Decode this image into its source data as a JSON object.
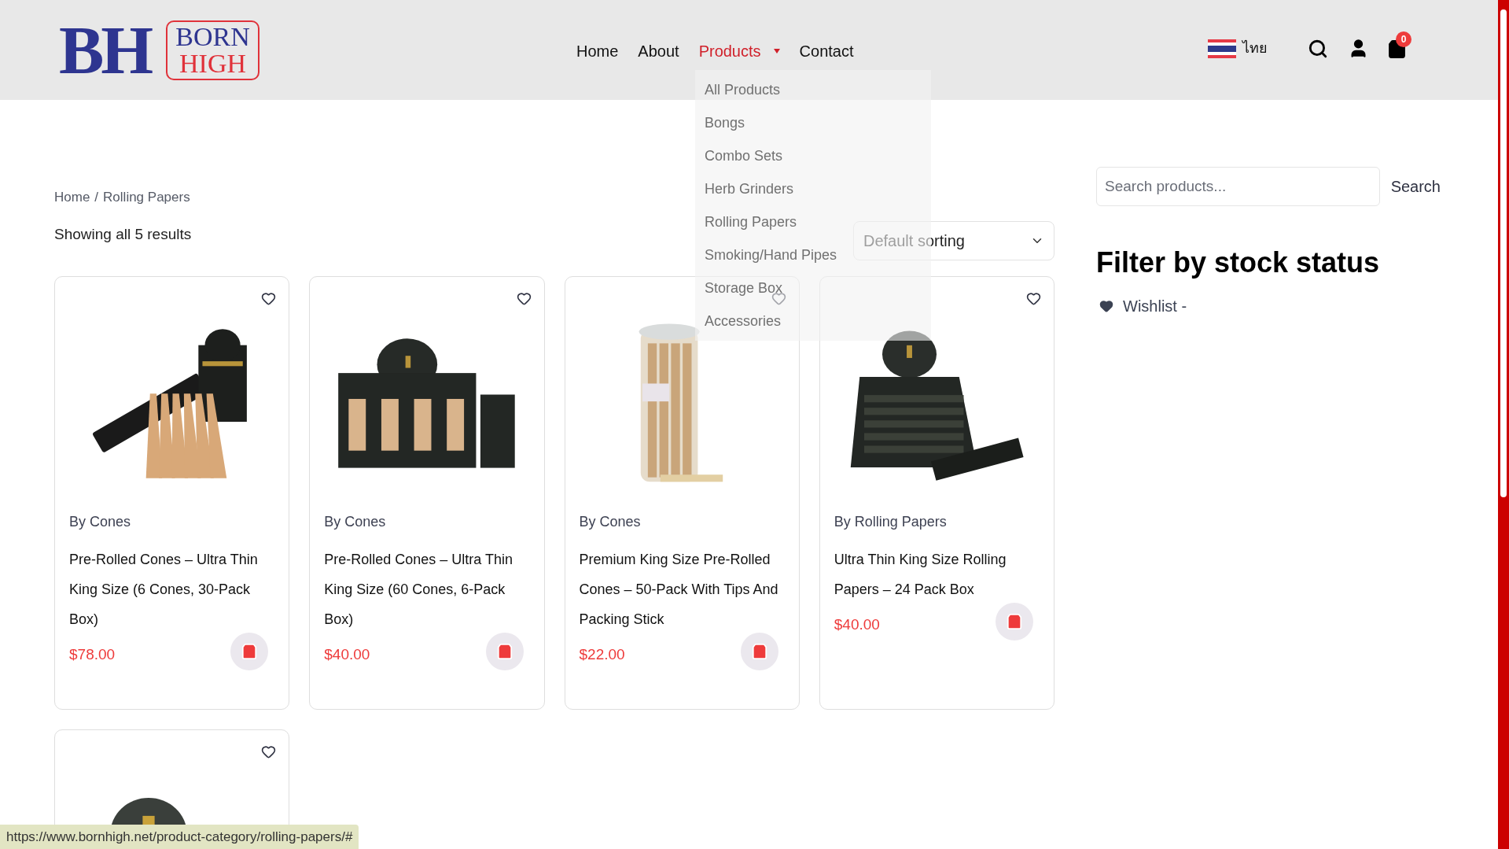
{
  "header": {
    "logo": {
      "monogram": "BH",
      "line1": "BORN",
      "line2": "HIGH"
    },
    "nav": [
      {
        "label": "Home",
        "selected": false,
        "has_menu": false
      },
      {
        "label": "About",
        "selected": false,
        "has_menu": false
      },
      {
        "label": "Products",
        "selected": true,
        "has_menu": true
      },
      {
        "label": "Contact",
        "selected": false,
        "has_menu": false
      }
    ],
    "language": "ไทย",
    "cart_count": "0"
  },
  "dropdown": [
    "All Products",
    "Bongs",
    "Combo Sets",
    "Herb Grinders",
    "Rolling Papers",
    "Smoking/Hand Pipes",
    "Storage Box",
    "Accessories"
  ],
  "breadcrumb": {
    "items": [
      "Home",
      "Rolling Papers"
    ],
    "separator": "/"
  },
  "result_count": "Showing all 5 results",
  "sorting": "Default sorting",
  "products": [
    {
      "category": "By Cones",
      "title": "Pre-Rolled Cones – Ultra Thin King Size (6 Cones, 30-Pack Box)",
      "price": "$78.00",
      "kind": "cones"
    },
    {
      "category": "By Cones",
      "title": "Pre-Rolled Cones – Ultra Thin King Size (60 Cones, 6-Pack Box)",
      "price": "$40.00",
      "kind": "display"
    },
    {
      "category": "By Cones",
      "title": "Premium King Size Pre-Rolled Cones – 50-Pack With Tips And Packing Stick",
      "price": "$22.00",
      "kind": "jar"
    },
    {
      "category": "By Rolling Papers",
      "title": "Ultra Thin King Size Rolling Papers – 24 Pack Box",
      "price": "$40.00",
      "kind": "papers"
    },
    {
      "kind": "partial"
    }
  ],
  "sidebar": {
    "search_placeholder": "Search products...",
    "search_button": "Search",
    "filter_title": "Filter by stock status",
    "wishlist": "Wishlist -"
  },
  "status_url": "https://www.bornhigh.net/product-category/rolling-papers/#"
}
